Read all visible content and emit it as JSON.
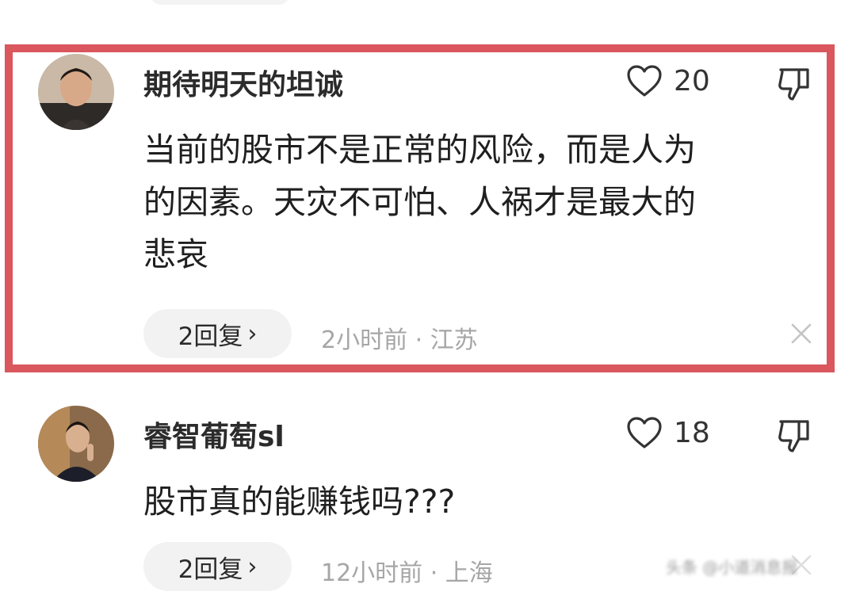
{
  "colors": {
    "highlight_border": "#d9575d",
    "pill_bg": "#f2f2f2",
    "meta_text": "#a6a6a6"
  },
  "comments": [
    {
      "username": "期待明天的坦诚",
      "like_count": "20",
      "text_lines": [
        "当前的股市不是正常的风险，而是人为",
        "的因素。天灾不可怕、人祸才是最大的",
        "悲哀"
      ],
      "reply_label": "2回复",
      "meta": "2小时前 · 江苏",
      "icons": [
        "heart-icon",
        "thumb-down-icon",
        "close-icon",
        "chevron-right-icon"
      ]
    },
    {
      "username": "睿智葡萄sl",
      "like_count": "18",
      "text_lines": [
        "股市真的能赚钱吗???"
      ],
      "reply_label": "2回复",
      "meta": "12小时前 · 上海",
      "icons": [
        "heart-icon",
        "thumb-down-icon",
        "close-icon",
        "chevron-right-icon"
      ]
    }
  ],
  "watermark": "头条 @小道消息报"
}
